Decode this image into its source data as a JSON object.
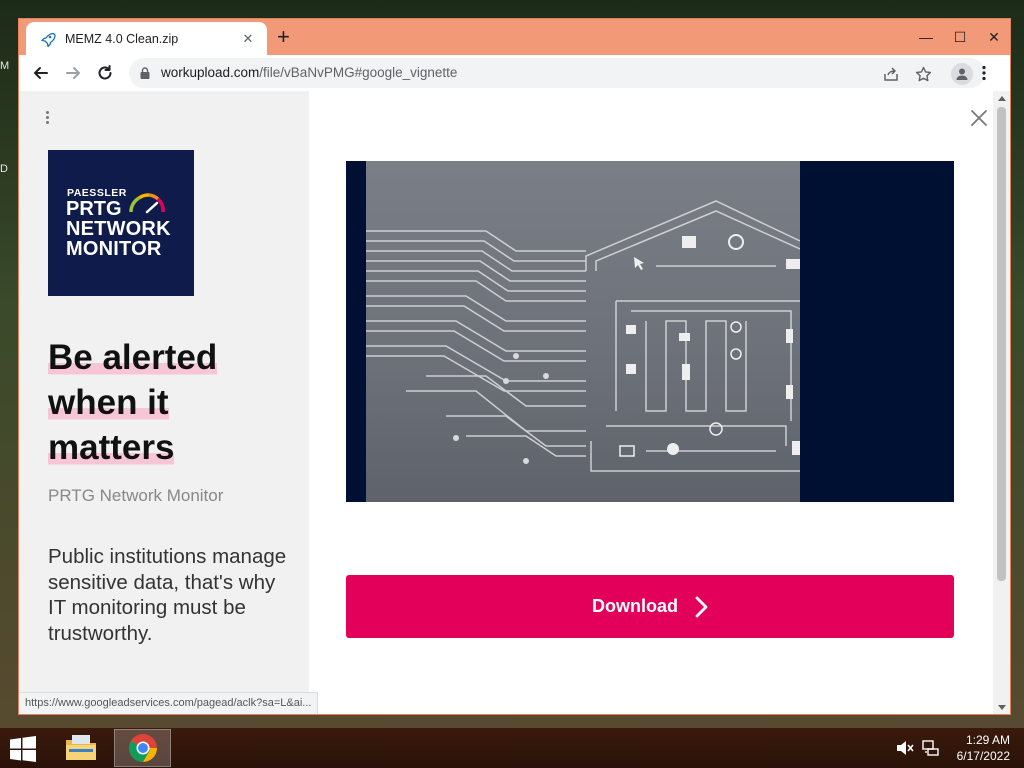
{
  "desktop": {
    "frag_top": "M",
    "frag_bottom": "D"
  },
  "browser": {
    "tab": {
      "title": "MEMZ 4.0 Clean.zip",
      "close_glyph": "✕"
    },
    "new_tab_glyph": "+",
    "window_controls": {
      "minimize": "—",
      "maximize": "☐",
      "close": "✕"
    },
    "omnibox": {
      "url_host": "workupload.com",
      "url_path": "/file/vBaNvPMG#google_vignette"
    },
    "status_url": "https://www.googleadservices.com/pagead/aclk?sa=L&ai..."
  },
  "ad": {
    "logo": {
      "line1": "PAESSLER",
      "line2": "PRTG",
      "line3": "NETWORK",
      "line4": "MONITOR"
    },
    "headline": [
      "Be alerted",
      "when it",
      "matters"
    ],
    "subtitle": "PRTG Network Monitor",
    "body": "Public institutions manage sensitive data, that's why IT monitoring must be trustworthy.",
    "download_label": "Download",
    "colors": {
      "accent": "#e3005a",
      "logo_bg": "#0f1b4a",
      "highlight": "#f7c6d6"
    }
  },
  "taskbar": {
    "items": [
      "start-icon",
      "file-explorer-icon",
      "chrome-icon"
    ],
    "tray": [
      "volume-muted-icon",
      "network-icon"
    ],
    "time": "1:29 AM",
    "date": "6/17/2022"
  }
}
